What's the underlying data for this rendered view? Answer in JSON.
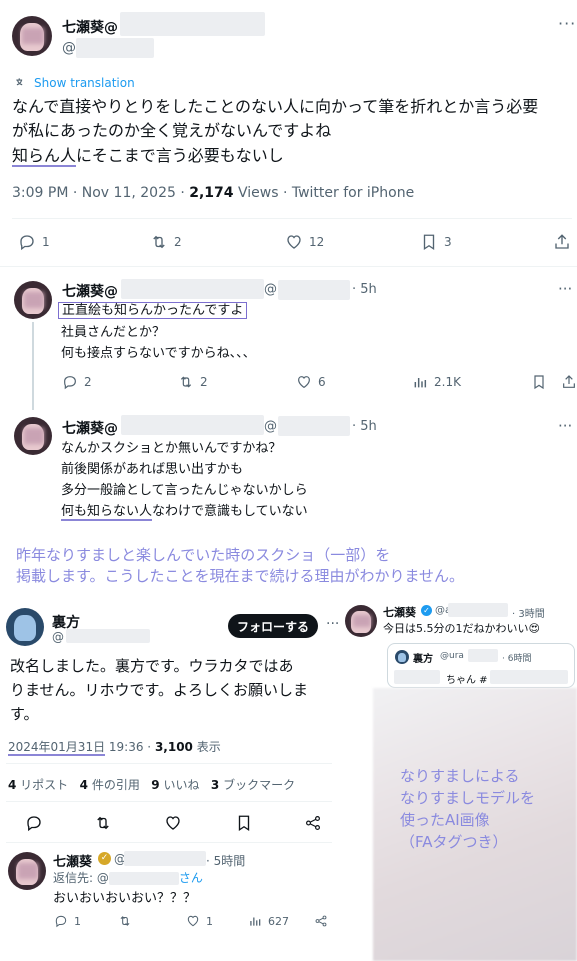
{
  "tweet": {
    "author_name": "七瀬葵@",
    "handle": "@",
    "show_translation": "Show translation",
    "text_line1": "なんで直接やりとりをしたことのない人に向かって筆を折れとか言う必要",
    "text_line2": "が私にあったのか全く覚えがないんですよね",
    "text_line3_hl": "知らん人",
    "text_line3_rest": "にそこまで言う必要もないし",
    "timestamp": "3:09 PM · Nov 11, 2025 · ",
    "views_count": "2,174",
    "views_label": " Views · Twitter for iPhone",
    "reply_count": "1",
    "retweet_count": "2",
    "like_count": "12",
    "bookmark_count": "3"
  },
  "reply1": {
    "author_name": "七瀬葵@",
    "at": "@",
    "time": "· 5h",
    "line1": "正直絵も知らんかったんですよ",
    "line2": "社員さんだとか？",
    "line3": "何も接点すらないですからね、、、",
    "reply_count": "2",
    "retweet_count": "2",
    "like_count": "6",
    "views": "2.1K"
  },
  "reply2": {
    "author_name": "七瀬葵@",
    "at": "@",
    "time": "· 5h",
    "line1": "なんかスクショとか無いんですかね？",
    "line2": "前後関係があれば思い出すかも",
    "line3": "多分一般論として言ったんじゃないかしら",
    "line4_hl": "何も知らない人",
    "line4_rest": "なわけで意識もしていない"
  },
  "note1": {
    "line1": "昨年なりすましと楽しんでいた時のスクショ（一部）を",
    "line2": "掲載します。こうしたことを現在まで続ける理由がわかりません。"
  },
  "ss_left": {
    "name": "裏方",
    "handle": "@",
    "follow_button": "フォローする",
    "text_line1": "改名しました。裏方です。ウラカタではあ",
    "text_line2": "りません。リホウです。よろしくお願いしま",
    "text_line3": "す。",
    "date_hl": "2024年01月31日",
    "date_rest": " 19:36 · ",
    "views": "3,100",
    "views_label": " 表示",
    "reposts": "4",
    "reposts_label": " リポスト",
    "quotes": "4",
    "quotes_label": " 件の引用",
    "likes": "9",
    "likes_label": " いいね",
    "bookmarks": "3",
    "bookmarks_label": " ブックマーク"
  },
  "ss_left_reply": {
    "name": "七瀬葵",
    "handle": "@",
    "time": "· 5時間",
    "reply_to": "返信先: @",
    "reply_to_suffix": "さん",
    "text": "おいおいおいおい？？？",
    "reply_count": "1",
    "like_count": "1",
    "views": "627"
  },
  "ss_right": {
    "name": "七瀬葵",
    "handle": "@a",
    "time": "· 3時間",
    "text": "今日は5.5分の1だねかわいい",
    "emoji": "😍",
    "quoted_name": "裏方",
    "quoted_handle": "@ura",
    "quoted_time": "· 6時間",
    "quoted_text": "ちゃん #"
  },
  "note2": {
    "line1": "なりすましによる",
    "line2": "なりすましモデルを",
    "line3": "使ったAI画像",
    "line4": "（FAタグつき）"
  },
  "colors": {
    "link": "#1d9bf0",
    "gray": "#536471",
    "highlight": "#7c6fcf",
    "note": "#8a8adf"
  }
}
